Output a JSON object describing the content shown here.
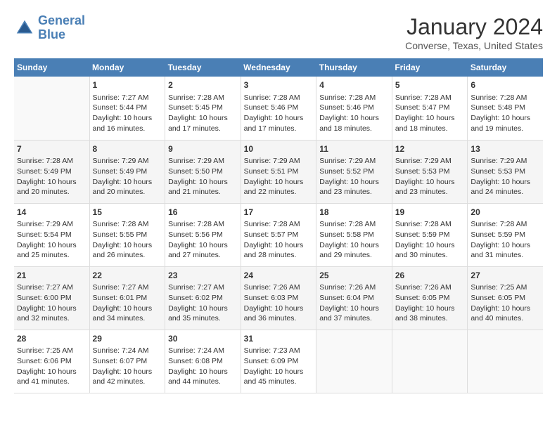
{
  "logo": {
    "line1": "General",
    "line2": "Blue"
  },
  "title": "January 2024",
  "subtitle": "Converse, Texas, United States",
  "days_header": [
    "Sunday",
    "Monday",
    "Tuesday",
    "Wednesday",
    "Thursday",
    "Friday",
    "Saturday"
  ],
  "weeks": [
    [
      {
        "num": "",
        "data": ""
      },
      {
        "num": "1",
        "data": "Sunrise: 7:27 AM\nSunset: 5:44 PM\nDaylight: 10 hours\nand 16 minutes."
      },
      {
        "num": "2",
        "data": "Sunrise: 7:28 AM\nSunset: 5:45 PM\nDaylight: 10 hours\nand 17 minutes."
      },
      {
        "num": "3",
        "data": "Sunrise: 7:28 AM\nSunset: 5:46 PM\nDaylight: 10 hours\nand 17 minutes."
      },
      {
        "num": "4",
        "data": "Sunrise: 7:28 AM\nSunset: 5:46 PM\nDaylight: 10 hours\nand 18 minutes."
      },
      {
        "num": "5",
        "data": "Sunrise: 7:28 AM\nSunset: 5:47 PM\nDaylight: 10 hours\nand 18 minutes."
      },
      {
        "num": "6",
        "data": "Sunrise: 7:28 AM\nSunset: 5:48 PM\nDaylight: 10 hours\nand 19 minutes."
      }
    ],
    [
      {
        "num": "7",
        "data": "Sunrise: 7:28 AM\nSunset: 5:49 PM\nDaylight: 10 hours\nand 20 minutes."
      },
      {
        "num": "8",
        "data": "Sunrise: 7:29 AM\nSunset: 5:49 PM\nDaylight: 10 hours\nand 20 minutes."
      },
      {
        "num": "9",
        "data": "Sunrise: 7:29 AM\nSunset: 5:50 PM\nDaylight: 10 hours\nand 21 minutes."
      },
      {
        "num": "10",
        "data": "Sunrise: 7:29 AM\nSunset: 5:51 PM\nDaylight: 10 hours\nand 22 minutes."
      },
      {
        "num": "11",
        "data": "Sunrise: 7:29 AM\nSunset: 5:52 PM\nDaylight: 10 hours\nand 23 minutes."
      },
      {
        "num": "12",
        "data": "Sunrise: 7:29 AM\nSunset: 5:53 PM\nDaylight: 10 hours\nand 23 minutes."
      },
      {
        "num": "13",
        "data": "Sunrise: 7:29 AM\nSunset: 5:53 PM\nDaylight: 10 hours\nand 24 minutes."
      }
    ],
    [
      {
        "num": "14",
        "data": "Sunrise: 7:29 AM\nSunset: 5:54 PM\nDaylight: 10 hours\nand 25 minutes."
      },
      {
        "num": "15",
        "data": "Sunrise: 7:28 AM\nSunset: 5:55 PM\nDaylight: 10 hours\nand 26 minutes."
      },
      {
        "num": "16",
        "data": "Sunrise: 7:28 AM\nSunset: 5:56 PM\nDaylight: 10 hours\nand 27 minutes."
      },
      {
        "num": "17",
        "data": "Sunrise: 7:28 AM\nSunset: 5:57 PM\nDaylight: 10 hours\nand 28 minutes."
      },
      {
        "num": "18",
        "data": "Sunrise: 7:28 AM\nSunset: 5:58 PM\nDaylight: 10 hours\nand 29 minutes."
      },
      {
        "num": "19",
        "data": "Sunrise: 7:28 AM\nSunset: 5:59 PM\nDaylight: 10 hours\nand 30 minutes."
      },
      {
        "num": "20",
        "data": "Sunrise: 7:28 AM\nSunset: 5:59 PM\nDaylight: 10 hours\nand 31 minutes."
      }
    ],
    [
      {
        "num": "21",
        "data": "Sunrise: 7:27 AM\nSunset: 6:00 PM\nDaylight: 10 hours\nand 32 minutes."
      },
      {
        "num": "22",
        "data": "Sunrise: 7:27 AM\nSunset: 6:01 PM\nDaylight: 10 hours\nand 34 minutes."
      },
      {
        "num": "23",
        "data": "Sunrise: 7:27 AM\nSunset: 6:02 PM\nDaylight: 10 hours\nand 35 minutes."
      },
      {
        "num": "24",
        "data": "Sunrise: 7:26 AM\nSunset: 6:03 PM\nDaylight: 10 hours\nand 36 minutes."
      },
      {
        "num": "25",
        "data": "Sunrise: 7:26 AM\nSunset: 6:04 PM\nDaylight: 10 hours\nand 37 minutes."
      },
      {
        "num": "26",
        "data": "Sunrise: 7:26 AM\nSunset: 6:05 PM\nDaylight: 10 hours\nand 38 minutes."
      },
      {
        "num": "27",
        "data": "Sunrise: 7:25 AM\nSunset: 6:05 PM\nDaylight: 10 hours\nand 40 minutes."
      }
    ],
    [
      {
        "num": "28",
        "data": "Sunrise: 7:25 AM\nSunset: 6:06 PM\nDaylight: 10 hours\nand 41 minutes."
      },
      {
        "num": "29",
        "data": "Sunrise: 7:24 AM\nSunset: 6:07 PM\nDaylight: 10 hours\nand 42 minutes."
      },
      {
        "num": "30",
        "data": "Sunrise: 7:24 AM\nSunset: 6:08 PM\nDaylight: 10 hours\nand 44 minutes."
      },
      {
        "num": "31",
        "data": "Sunrise: 7:23 AM\nSunset: 6:09 PM\nDaylight: 10 hours\nand 45 minutes."
      },
      {
        "num": "",
        "data": ""
      },
      {
        "num": "",
        "data": ""
      },
      {
        "num": "",
        "data": ""
      }
    ]
  ]
}
